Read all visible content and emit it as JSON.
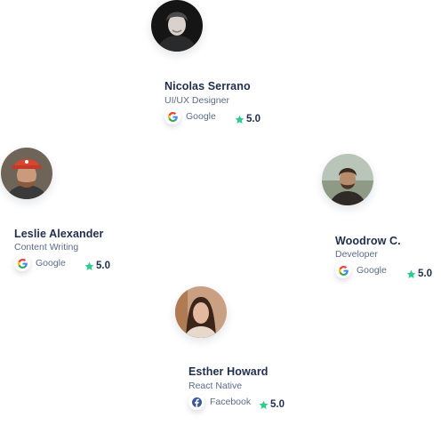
{
  "colors": {
    "name": "#1f2d4d",
    "muted": "#5b6b88",
    "star": "#2ecc8f",
    "facebook": "#3b5998"
  },
  "reviewers": [
    {
      "name": "Nicolas Serrano",
      "role": "UI/UX Designer",
      "source": "Google",
      "source_icon": "google-icon",
      "rating": "5.0"
    },
    {
      "name": "Leslie Alexander",
      "role": "Content Writing",
      "source": "Google",
      "source_icon": "google-icon",
      "rating": "5.0"
    },
    {
      "name": "Woodrow C.",
      "role": "Developer",
      "source": "Google",
      "source_icon": "google-icon",
      "rating": "5.0"
    },
    {
      "name": "Esther Howard",
      "role": "React Native",
      "source": "Facebook",
      "source_icon": "facebook-icon",
      "rating": "5.0"
    }
  ]
}
